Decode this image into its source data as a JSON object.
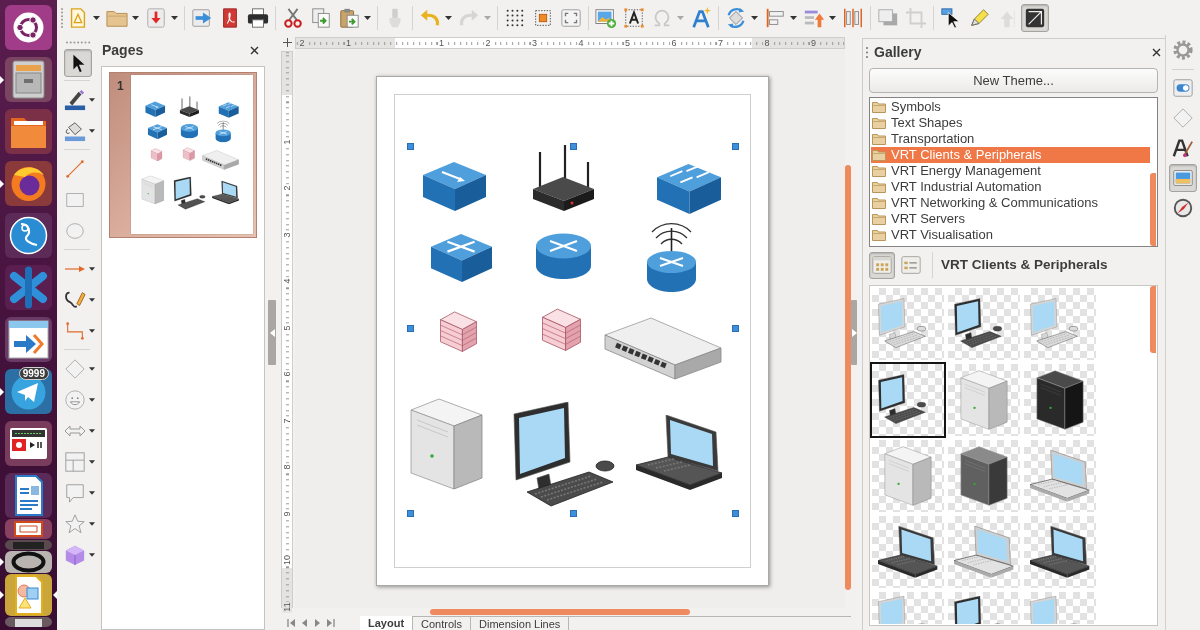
{
  "launcher": [
    {
      "running": false,
      "focused": false
    },
    {
      "running": true,
      "focused": false
    },
    {
      "running": false,
      "focused": false
    },
    {
      "running": true,
      "focused": false
    },
    {
      "running": false,
      "focused": false
    },
    {
      "running": false,
      "focused": false
    },
    {
      "running": false,
      "focused": false
    },
    {
      "running": true,
      "focused": false,
      "badge": "9999"
    },
    {
      "running": false,
      "focused": false
    },
    {
      "running": false,
      "focused": false
    },
    {
      "running": false,
      "focused": false
    },
    {
      "running": false,
      "focused": false
    },
    {
      "running": true,
      "focused": false
    },
    {
      "running": true,
      "focused": true
    },
    {
      "running": false,
      "focused": false
    }
  ],
  "toolbar": [
    [
      {
        "disabled": false,
        "on": false,
        "dropdown": true
      },
      {
        "disabled": false,
        "on": false,
        "dropdown": true
      },
      {
        "disabled": false,
        "on": false,
        "dropdown": true
      }
    ],
    [
      {
        "disabled": false,
        "on": false,
        "dropdown": false
      },
      {
        "disabled": false,
        "on": false,
        "dropdown": false
      },
      {
        "disabled": false,
        "on": false,
        "dropdown": false
      }
    ],
    [
      {
        "disabled": false,
        "on": false,
        "dropdown": false
      },
      {
        "disabled": false,
        "on": false,
        "dropdown": false
      },
      {
        "disabled": false,
        "on": false,
        "dropdown": true
      }
    ],
    [
      {
        "disabled": true,
        "on": false,
        "dropdown": false
      }
    ],
    [
      {
        "disabled": false,
        "on": false,
        "dropdown": true
      },
      {
        "disabled": true,
        "on": false,
        "dropdown": true
      }
    ],
    [
      {
        "disabled": false,
        "on": false,
        "dropdown": false
      },
      {
        "disabled": false,
        "on": false,
        "dropdown": false
      },
      {
        "disabled": false,
        "on": false,
        "dropdown": false
      }
    ],
    [
      {
        "disabled": false,
        "on": false,
        "dropdown": false
      },
      {
        "disabled": false,
        "on": false,
        "dropdown": false
      },
      {
        "disabled": true,
        "on": false,
        "dropdown": true
      },
      {
        "disabled": false,
        "on": false,
        "dropdown": false
      }
    ],
    [
      {
        "disabled": false,
        "on": false,
        "dropdown": true
      },
      {
        "disabled": false,
        "on": false,
        "dropdown": true
      },
      {
        "disabled": false,
        "on": false,
        "dropdown": true
      },
      {
        "disabled": false,
        "on": false,
        "dropdown": false
      }
    ],
    [
      {
        "disabled": false,
        "on": false,
        "dropdown": false
      },
      {
        "disabled": true,
        "on": false,
        "dropdown": false
      }
    ],
    [
      {
        "disabled": false,
        "on": false,
        "dropdown": false
      },
      {
        "disabled": false,
        "on": false,
        "dropdown": false
      },
      {
        "disabled": true,
        "on": false,
        "dropdown": false
      },
      {
        "disabled": false,
        "on": true,
        "dropdown": false
      }
    ]
  ],
  "drawing_tools": [
    [
      {
        "on": true,
        "dropdown": false
      }
    ],
    [
      {
        "on": false,
        "dropdown": true
      },
      {
        "on": false,
        "dropdown": true
      }
    ],
    [
      {
        "on": false,
        "dropdown": false
      },
      {
        "on": false,
        "dropdown": false
      },
      {
        "on": false,
        "dropdown": false
      }
    ],
    [
      {
        "on": false,
        "dropdown": true
      },
      {
        "on": false,
        "dropdown": true
      },
      {
        "on": false,
        "dropdown": true
      }
    ],
    [
      {
        "on": false,
        "dropdown": true
      },
      {
        "on": false,
        "dropdown": true
      },
      {
        "on": false,
        "dropdown": true
      },
      {
        "on": false,
        "dropdown": true
      },
      {
        "on": false,
        "dropdown": true
      },
      {
        "on": false,
        "dropdown": true
      },
      {
        "on": false,
        "dropdown": true
      }
    ]
  ],
  "pages_panel": {
    "title": "Pages",
    "pages": [
      {
        "number": "1",
        "selected": true
      }
    ]
  },
  "rulers": {
    "horizontal_before_origin": [
      "2",
      "1"
    ],
    "horizontal": [
      "1",
      "2",
      "3",
      "4",
      "5",
      "6",
      "7",
      "8",
      "9"
    ],
    "vertical": [
      "1",
      "2",
      "3",
      "4",
      "5",
      "6",
      "7",
      "8",
      "9",
      "10",
      "11"
    ]
  },
  "canvas": {
    "selected": true
  },
  "sheet_tabs": [
    {
      "label": "Layout",
      "selected": true
    },
    {
      "label": "Controls",
      "selected": false
    },
    {
      "label": "Dimension Lines",
      "selected": false
    }
  ],
  "gallery": {
    "title": "Gallery",
    "new_theme_button": "New Theme...",
    "themes": [
      {
        "label": "Symbols",
        "selected": false
      },
      {
        "label": "Text Shapes",
        "selected": false
      },
      {
        "label": "Transportation",
        "selected": false
      },
      {
        "label": "VRT Clients & Peripherals",
        "selected": true
      },
      {
        "label": "VRT Energy Management",
        "selected": false
      },
      {
        "label": "VRT Industrial Automation",
        "selected": false
      },
      {
        "label": "VRT Networking & Communications",
        "selected": false
      },
      {
        "label": "VRT Servers",
        "selected": false
      },
      {
        "label": "VRT Visualisation",
        "selected": false
      }
    ],
    "view_buttons": [
      {
        "selected": true
      },
      {
        "selected": false
      }
    ],
    "theme_title": "VRT Clients & Peripherals",
    "items": [
      {
        "selected": false
      },
      {
        "selected": false
      },
      {
        "selected": false
      },
      {
        "selected": true
      },
      {
        "selected": false
      },
      {
        "selected": false
      },
      {
        "selected": false
      },
      {
        "selected": false
      },
      {
        "selected": false
      },
      {
        "selected": false
      },
      {
        "selected": false
      },
      {
        "selected": false
      },
      {
        "selected": false
      },
      {
        "selected": false
      },
      {
        "selected": false
      }
    ]
  },
  "deck_tabs": [
    {
      "selected": false
    },
    {
      "selected": false
    },
    {
      "selected": false
    },
    {
      "selected": true
    },
    {
      "selected": false
    }
  ]
}
